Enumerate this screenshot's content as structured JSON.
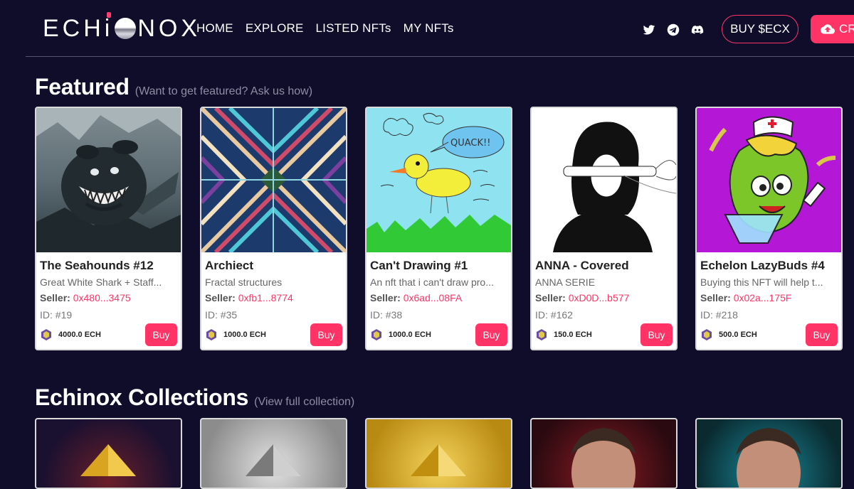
{
  "header": {
    "logo_text_left": "ECH",
    "logo_text_right": "NOX",
    "nav": [
      "HOME",
      "EXPLORE",
      "LISTED NFTs",
      "MY NFTs"
    ],
    "socials": [
      "twitter-icon",
      "telegram-icon",
      "discord-icon"
    ],
    "buy_label": "BUY $ECX",
    "create_label": "CR"
  },
  "featured": {
    "title": "Featured",
    "subtitle": "(Want to get featured? Ask us how)",
    "cards": [
      {
        "name": "The Seahounds #12",
        "desc": "Great White Shark + Staff...",
        "seller_label": "Seller:",
        "seller": "0x480...3475",
        "id": "ID: #19",
        "price": "4000.0 ECH",
        "buy": "Buy"
      },
      {
        "name": "Archiect",
        "desc": "Fractal structures",
        "seller_label": "Seller:",
        "seller": "0xfb1...8774",
        "id": "ID: #35",
        "price": "1000.0 ECH",
        "buy": "Buy"
      },
      {
        "name": "Can't Drawing #1",
        "desc": "An nft that i can't draw pro...",
        "seller_label": "Seller:",
        "seller": "0x6ad...08FA",
        "id": "ID: #38",
        "price": "1000.0 ECH",
        "buy": "Buy"
      },
      {
        "name": "ANNA - Covered",
        "desc": "ANNA SERIE",
        "seller_label": "Seller:",
        "seller": "0xD0D...b577",
        "id": "ID: #162",
        "price": "150.0 ECH",
        "buy": "Buy"
      },
      {
        "name": "Echelon LazyBuds #4",
        "desc": "Buying this NFT will help t...",
        "seller_label": "Seller:",
        "seller": "0x02a...175F",
        "id": "ID: #218",
        "price": "500.0 ECH",
        "buy": "Buy"
      }
    ]
  },
  "collections": {
    "title": "Echinox Collections",
    "subtitle": "(View full collection)"
  },
  "art": {
    "duck_speech": "QUACK!!"
  },
  "colors": {
    "background": "#100d2b",
    "accent": "#ff3366"
  }
}
